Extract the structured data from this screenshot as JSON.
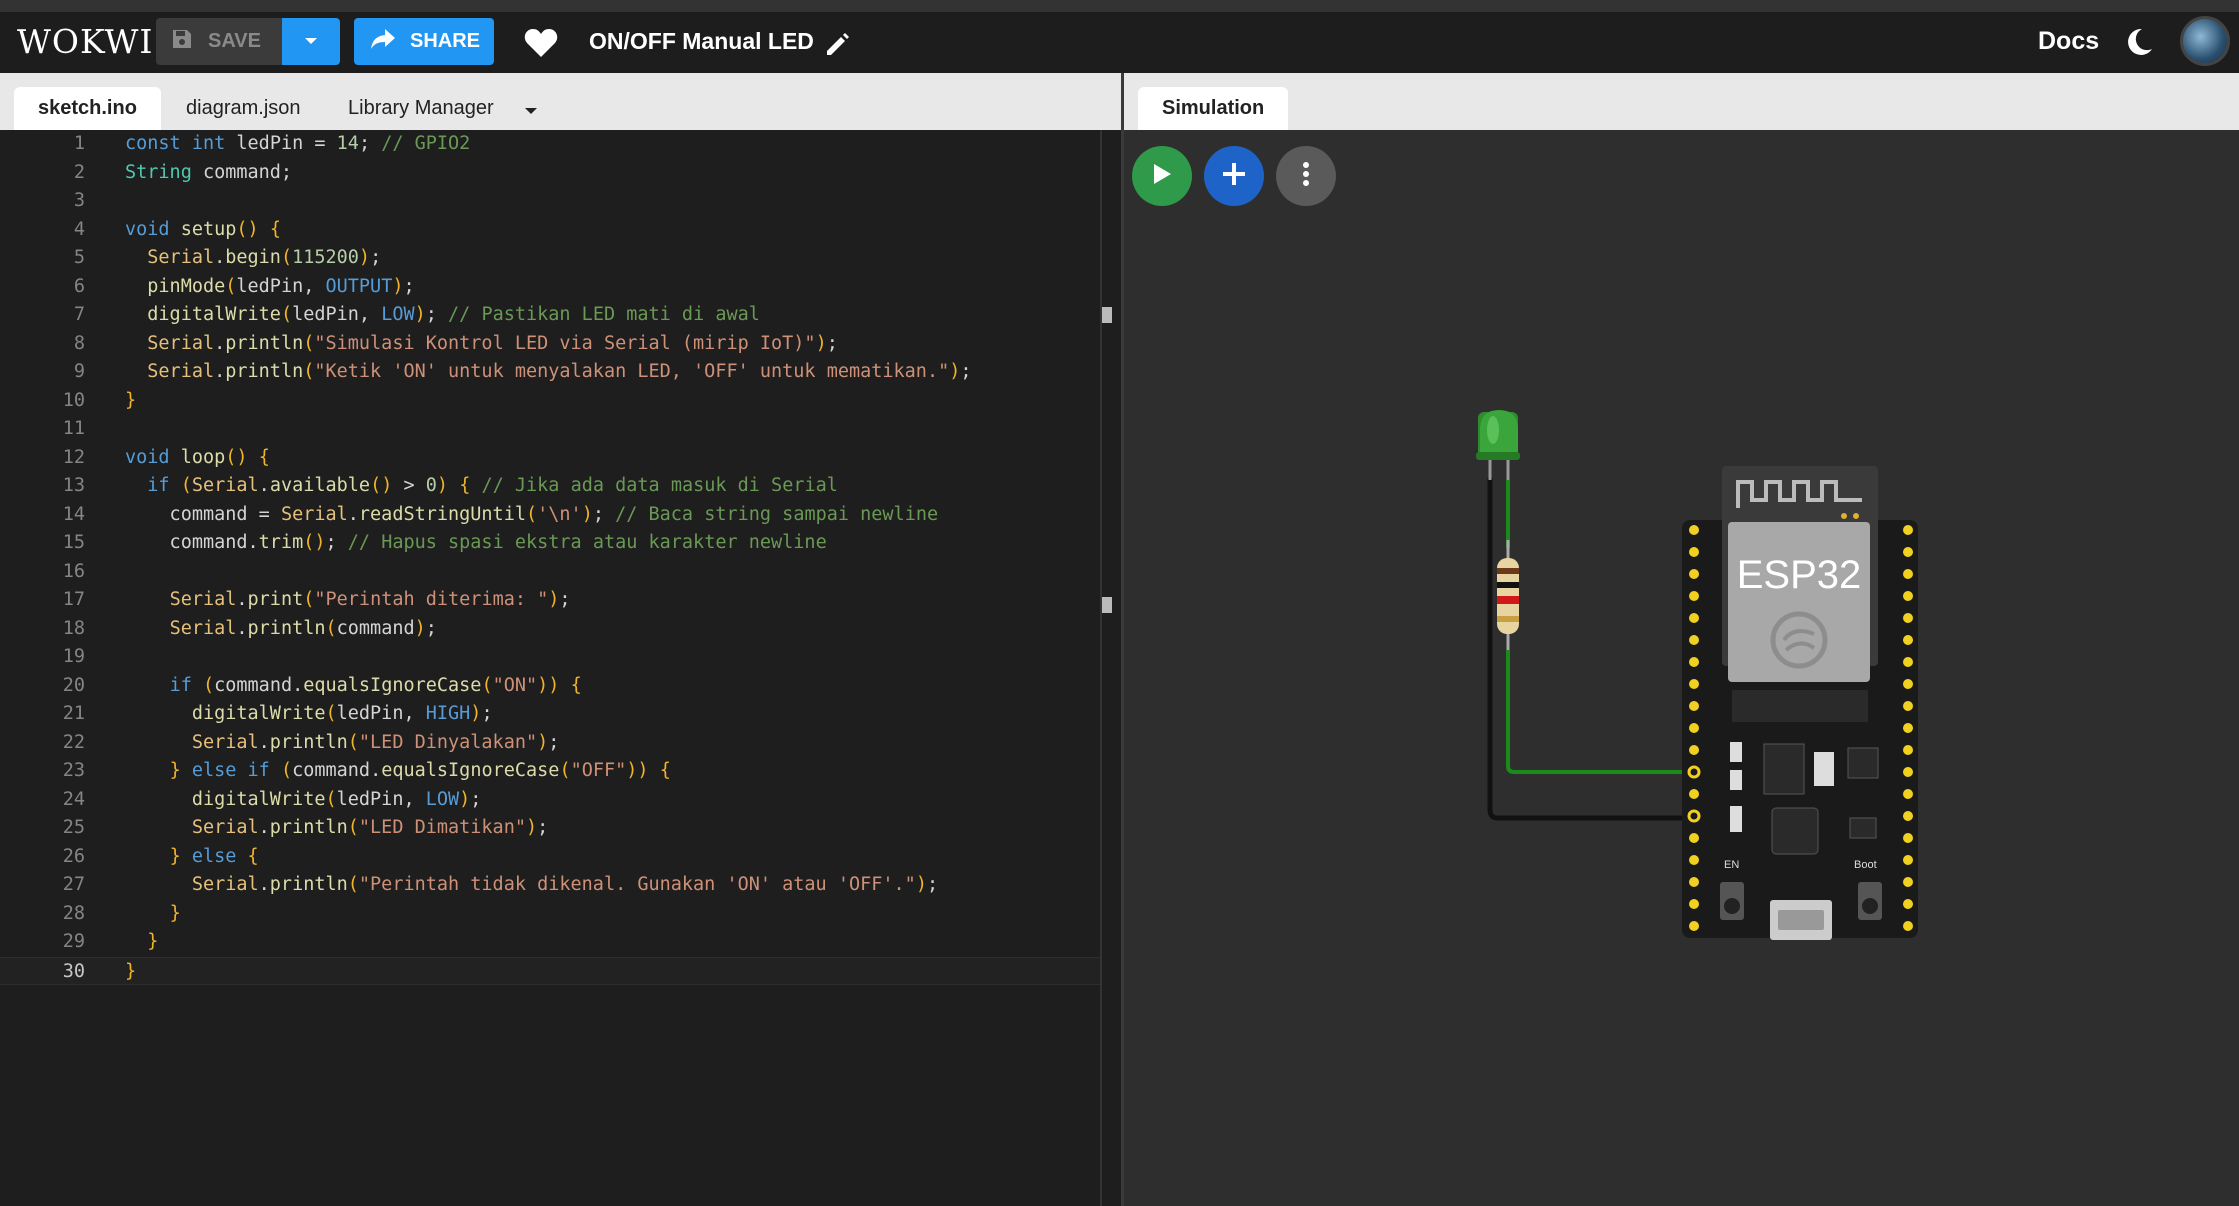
{
  "header": {
    "logo": "WOKWI",
    "save_label": "SAVE",
    "share_label": "SHARE",
    "project_title": "ON/OFF Manual LED",
    "docs_label": "Docs"
  },
  "editor": {
    "tabs": [
      "sketch.ino",
      "diagram.json",
      "Library Manager"
    ],
    "active_tab": "sketch.ino",
    "line_numbers": [
      "1",
      "2",
      "3",
      "4",
      "5",
      "6",
      "7",
      "8",
      "9",
      "10",
      "11",
      "12",
      "13",
      "14",
      "15",
      "16",
      "17",
      "18",
      "19",
      "20",
      "21",
      "22",
      "23",
      "24",
      "25",
      "26",
      "27",
      "28",
      "29",
      "30"
    ],
    "code_lines": [
      "const int ledPin = 14; // GPIO2",
      "String command;",
      "",
      "void setup() {",
      "  Serial.begin(115200);",
      "  pinMode(ledPin, OUTPUT);",
      "  digitalWrite(ledPin, LOW); // Pastikan LED mati di awal",
      "  Serial.println(\"Simulasi Kontrol LED via Serial (mirip IoT)\");",
      "  Serial.println(\"Ketik 'ON' untuk menyalakan LED, 'OFF' untuk mematikan.\");",
      "}",
      "",
      "void loop() {",
      "  if (Serial.available() > 0) { // Jika ada data masuk di Serial",
      "    command = Serial.readStringUntil('\\n'); // Baca string sampai newline",
      "    command.trim(); // Hapus spasi ekstra atau karakter newline",
      "",
      "    Serial.print(\"Perintah diterima: \");",
      "    Serial.println(command);",
      "",
      "    if (command.equalsIgnoreCase(\"ON\")) {",
      "      digitalWrite(ledPin, HIGH);",
      "      Serial.println(\"LED Dinyalakan\");",
      "    } else if (command.equalsIgnoreCase(\"OFF\")) {",
      "      digitalWrite(ledPin, LOW);",
      "      Serial.println(\"LED Dimatikan\");",
      "    } else {",
      "      Serial.println(\"Perintah tidak dikenal. Gunakan 'ON' atau 'OFF'.\");",
      "    }",
      "  }",
      "}"
    ],
    "current_line": "30"
  },
  "simulation": {
    "tab_label": "Simulation",
    "board_label": "ESP32",
    "en_label": "EN",
    "boot_label": "Boot",
    "led_color": "#3a9a3a",
    "wire_color": "#1a8a1a",
    "buttons": [
      "play-icon",
      "plus-icon",
      "more-vert-icon"
    ]
  },
  "colors": {
    "accent": "#2196f3",
    "header_bg": "#1d1d1d",
    "editor_bg": "#1e1e1e",
    "sim_bg": "#2e2e2e",
    "play_green": "#2e9a4a"
  }
}
